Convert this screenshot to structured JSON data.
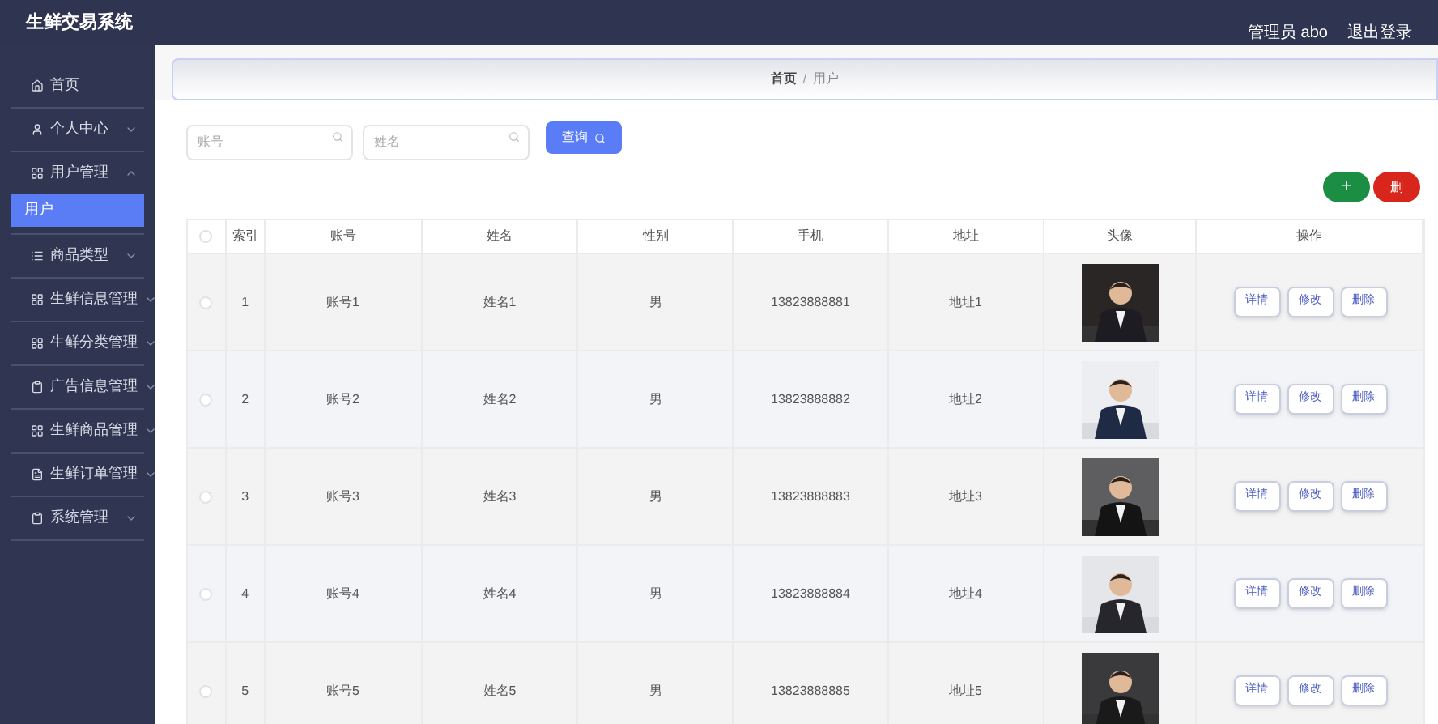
{
  "header": {
    "title": "生鲜交易系统",
    "user": "管理员 abo",
    "logout": "退出登录"
  },
  "sidebar": {
    "items": [
      {
        "label": "首页",
        "selected": false
      },
      {
        "label": "个人中心",
        "selected": false,
        "expanded": false
      },
      {
        "label": "用户管理",
        "selected": false,
        "expanded": true,
        "children": [
          {
            "label": "用户",
            "selected": true
          }
        ]
      },
      {
        "label": "商品类型",
        "selected": false,
        "expanded": false
      },
      {
        "label": "生鲜信息管理",
        "selected": false,
        "expanded": false
      },
      {
        "label": "生鲜分类管理",
        "selected": false,
        "expanded": false
      },
      {
        "label": "广告信息管理",
        "selected": false,
        "expanded": false
      },
      {
        "label": "生鲜商品管理",
        "selected": false,
        "expanded": false
      },
      {
        "label": "生鲜订单管理",
        "selected": false,
        "expanded": false
      },
      {
        "label": "系统管理",
        "selected": false,
        "expanded": false
      }
    ]
  },
  "breadcrumb": {
    "items": [
      "首页",
      "用户"
    ],
    "separator": "/"
  },
  "search": {
    "fields": [
      {
        "placeholder": "账号"
      },
      {
        "placeholder": "姓名"
      }
    ],
    "button": "查询"
  },
  "actions": {
    "add": "+",
    "delete": "删"
  },
  "table": {
    "select_all": {
      "checked": false
    },
    "columns": [
      "索引",
      "账号",
      "姓名",
      "性别",
      "手机",
      "地址",
      "头像",
      "操作"
    ],
    "rows": [
      {
        "checked": false,
        "cells": [
          "1",
          "账号1",
          "姓名1",
          "男",
          "13823888881",
          "地址1"
        ],
        "buttons": [
          "详情",
          "修改",
          "删除"
        ]
      },
      {
        "checked": false,
        "cells": [
          "2",
          "账号2",
          "姓名2",
          "男",
          "13823888882",
          "地址2"
        ],
        "buttons": [
          "详情",
          "修改",
          "删除"
        ]
      },
      {
        "checked": false,
        "cells": [
          "3",
          "账号3",
          "姓名3",
          "男",
          "13823888883",
          "地址3"
        ],
        "buttons": [
          "详情",
          "修改",
          "删除"
        ]
      },
      {
        "checked": false,
        "cells": [
          "4",
          "账号4",
          "姓名4",
          "男",
          "13823888884",
          "地址4"
        ],
        "buttons": [
          "详情",
          "修改",
          "删除"
        ]
      },
      {
        "checked": false,
        "cells": [
          "5",
          "账号5",
          "姓名5",
          "男",
          "13823888885",
          "地址5"
        ],
        "buttons": [
          "详情",
          "修改",
          "删除"
        ]
      }
    ]
  }
}
